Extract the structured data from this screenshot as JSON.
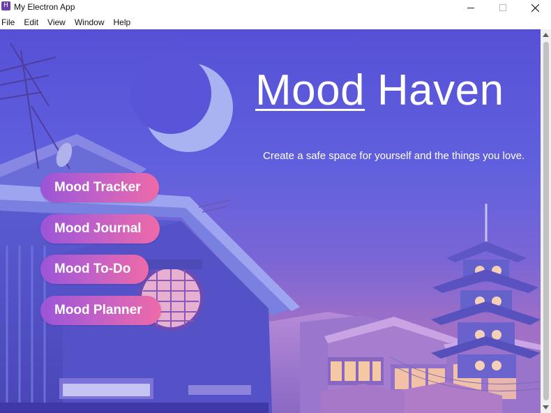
{
  "window": {
    "title": "My Electron App",
    "app_icon_glyph": "H"
  },
  "menu": {
    "items": [
      "File",
      "Edit",
      "View",
      "Window",
      "Help"
    ]
  },
  "hero": {
    "title_word_1": "Mood",
    "title_word_2": "Haven",
    "tagline": "Create a safe space for yourself and the things you love."
  },
  "nav": {
    "buttons": [
      "Mood Tracker",
      "Mood Journal",
      "Mood To-Do",
      "Mood Planner"
    ]
  },
  "colors": {
    "button_gradient_start": "#9a55d8",
    "button_gradient_end": "#ee6aa8",
    "sky_top": "#5a50d8",
    "sky_bottom": "#9a6cc0",
    "moon": "#a8b4f4",
    "text": "#ffffff"
  }
}
